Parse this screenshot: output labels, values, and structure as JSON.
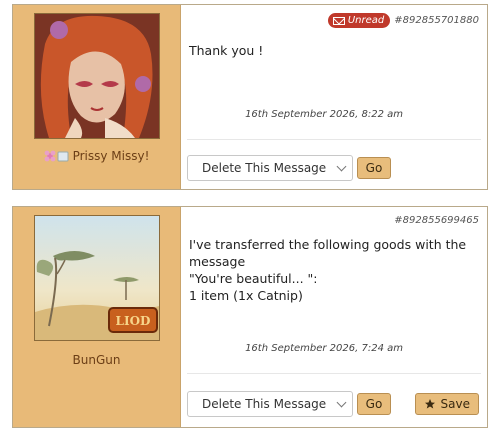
{
  "messages": [
    {
      "status_badge": "Unread",
      "id": "#892855701880",
      "body_lines": [
        "Thank you !"
      ],
      "date": "16th September 2026, 8:22 am",
      "sender": "Prissy Missy!",
      "action_select": "Delete This Message",
      "go_label": "Go"
    },
    {
      "id": "#892855699465",
      "body_lines": [
        "I've transferred the following goods with the message",
        "\"You're beautiful... \":",
        "1 item (1x Catnip)"
      ],
      "date": "16th September 2026, 7:24 am",
      "sender": "BunGun",
      "action_select": "Delete This Message",
      "go_label": "Go",
      "save_label": "Save"
    }
  ],
  "avatar2_logo_text": "LIOD",
  "colors": {
    "sidebar": "#e8ba78",
    "button": "#e8bd7c",
    "unread_badge": "#c0392b",
    "username": "#6b3e16"
  }
}
